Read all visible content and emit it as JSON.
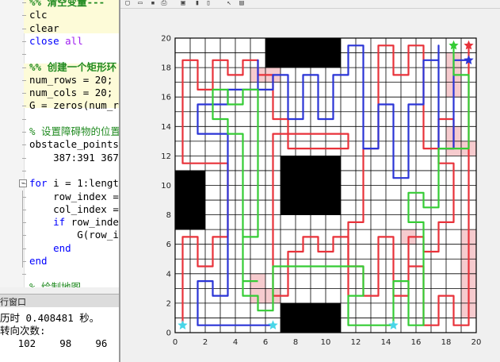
{
  "editor": {
    "lines": [
      {
        "text_cell": "%% 清空变量---",
        "top": -6
      },
      {
        "text": "clc"
      },
      {
        "text": "clear"
      },
      {
        "kw": "close ",
        "str": "all"
      },
      {
        "blank": true
      },
      {
        "text_cell": "%% 创建一个矩形环"
      },
      {
        "text": "num_rows = 20;"
      },
      {
        "text": "num_cols = 20;"
      },
      {
        "text": "G = zeros(num_row"
      },
      {
        "blank": true
      },
      {
        "text_cm": "% 设置障碍物的位置"
      },
      {
        "text": "obstacle_points ="
      },
      {
        "text": "    387:391 367:3"
      },
      {
        "blank": true
      },
      {
        "kw": "for ",
        "text": "i = 1:length("
      },
      {
        "text": "    row_index = c"
      },
      {
        "text": "    col_index = m"
      },
      {
        "kw": "    if ",
        "text": "row_index "
      },
      {
        "text": "        G(row_ind"
      },
      {
        "kw": "    end"
      },
      {
        "kw": "end"
      },
      {
        "blank": true
      },
      {
        "text_cm": "% 绘制地图"
      }
    ]
  },
  "command_window": {
    "title": "行窗口",
    "lines": [
      "历时 0.408481 秒。",
      "转向次数:",
      "   102    98    96"
    ]
  },
  "toolbar": {
    "icons": [
      "new-figure-icon",
      "open-icon",
      "save-icon",
      "print-icon",
      "print-preview-icon",
      "insert-colorbar-icon",
      "insert-legend-icon",
      "pointer-icon",
      "property-editor-icon"
    ]
  },
  "chart_data": {
    "type": "line",
    "xlim": [
      0,
      20
    ],
    "ylim": [
      0,
      20
    ],
    "xticks": [
      0,
      2,
      4,
      6,
      8,
      10,
      12,
      14,
      16,
      18,
      20
    ],
    "yticks": [
      0,
      2,
      4,
      6,
      8,
      10,
      12,
      14,
      16,
      18,
      20
    ],
    "grid": true,
    "obstacles": [
      {
        "x": [
          6,
          11
        ],
        "y": [
          18,
          20
        ]
      },
      {
        "x": [
          7,
          11
        ],
        "y": [
          8,
          12
        ]
      },
      {
        "x": [
          0,
          2
        ],
        "y": [
          7,
          11
        ]
      },
      {
        "x": [
          7,
          11
        ],
        "y": [
          0,
          2
        ]
      }
    ],
    "overlap_cells": [
      [
        5,
        17
      ],
      [
        6,
        17
      ],
      [
        18,
        18
      ],
      [
        18,
        17
      ],
      [
        18,
        16
      ],
      [
        18,
        13
      ],
      [
        18,
        12
      ],
      [
        19,
        12
      ],
      [
        15,
        6
      ],
      [
        19,
        6
      ],
      [
        19,
        5
      ],
      [
        19,
        4
      ],
      [
        19,
        3
      ],
      [
        19,
        2
      ],
      [
        19,
        1
      ],
      [
        6,
        2
      ],
      [
        5,
        2
      ],
      [
        5,
        3
      ]
    ],
    "series": [
      {
        "color": "#e8323a",
        "start": [
          19.5,
          18.5
        ],
        "end": [
          0.5,
          0.5
        ],
        "points": [
          [
            19.5,
            19.5
          ],
          [
            19.5,
            14.5
          ],
          [
            19.5,
            6.5
          ],
          [
            19.5,
            0.5
          ],
          [
            18.5,
            0.5
          ],
          [
            18.5,
            2.5
          ],
          [
            17.5,
            2.5
          ],
          [
            17.5,
            0.5
          ],
          [
            16.5,
            0.5
          ],
          [
            16.5,
            4.5
          ],
          [
            15.5,
            4.5
          ],
          [
            15.5,
            6.5
          ],
          [
            16.5,
            6.5
          ],
          [
            16.5,
            5.5
          ],
          [
            17.5,
            5.5
          ],
          [
            17.5,
            7.5
          ],
          [
            18.5,
            7.5
          ],
          [
            18.5,
            11.5
          ],
          [
            17.5,
            11.5
          ],
          [
            17.5,
            12.5
          ],
          [
            18.5,
            12.5
          ],
          [
            18.5,
            14.5
          ],
          [
            17.5,
            14.5
          ],
          [
            17.5,
            11.5
          ],
          [
            17.5,
            12.5
          ],
          [
            16.5,
            12.5
          ],
          [
            16.5,
            19.5
          ],
          [
            15.5,
            19.5
          ],
          [
            15.5,
            17.5
          ],
          [
            14.5,
            17.5
          ],
          [
            14.5,
            19.5
          ],
          [
            13.5,
            19.5
          ],
          [
            13.5,
            12.5
          ],
          [
            12.5,
            12.5
          ],
          [
            12.5,
            7.5
          ],
          [
            11.5,
            7.5
          ],
          [
            11.5,
            4.5
          ],
          [
            12.5,
            4.5
          ],
          [
            12.5,
            2.5
          ],
          [
            13.5,
            2.5
          ],
          [
            13.5,
            6.5
          ],
          [
            14.5,
            6.5
          ],
          [
            14.5,
            2.5
          ],
          [
            15.5,
            2.5
          ],
          [
            15.5,
            4.5
          ],
          [
            16.5,
            4.5
          ],
          [
            16.5,
            0.5
          ],
          [
            16.5,
            4.5
          ]
        ],
        "extra_runs": [
          [
            [
              0.5,
              0.5
            ],
            [
              0.5,
              6.5
            ],
            [
              1.5,
              6.5
            ],
            [
              1.5,
              4.5
            ],
            [
              2.5,
              4.5
            ],
            [
              2.5,
              6.5
            ],
            [
              3.5,
              6.5
            ],
            [
              3.5,
              11.5
            ],
            [
              0.5,
              11.5
            ],
            [
              0.5,
              18.5
            ],
            [
              1.5,
              18.5
            ],
            [
              1.5,
              16.5
            ],
            [
              2.5,
              16.5
            ],
            [
              2.5,
              18.5
            ],
            [
              3.5,
              18.5
            ],
            [
              3.5,
              17.5
            ],
            [
              4.5,
              17.5
            ],
            [
              4.5,
              18.5
            ],
            [
              5.5,
              18.5
            ],
            [
              5.5,
              17.5
            ],
            [
              6.5,
              17.5
            ],
            [
              6.5,
              14.5
            ],
            [
              7.5,
              14.5
            ],
            [
              7.5,
              12.5
            ],
            [
              11.5,
              12.5
            ],
            [
              11.5,
              13.5
            ],
            [
              6.5,
              13.5
            ],
            [
              6.5,
              2.5
            ],
            [
              7.5,
              2.5
            ],
            [
              7.5,
              5.5
            ],
            [
              8.5,
              5.5
            ],
            [
              8.5,
              6.5
            ],
            [
              9.5,
              6.5
            ],
            [
              9.5,
              5.5
            ],
            [
              10.5,
              5.5
            ],
            [
              10.5,
              6.5
            ],
            [
              11.5,
              6.5
            ],
            [
              11.5,
              2.5
            ]
          ]
        ]
      },
      {
        "color": "#2b35d6",
        "start": [
          19.5,
          18.5
        ],
        "end": [
          6.5,
          0.5
        ],
        "points": [
          [
            19.5,
            18.5
          ],
          [
            18.5,
            18.5
          ],
          [
            18.5,
            12.5
          ],
          [
            17.5,
            12.5
          ],
          [
            17.5,
            19.5
          ],
          [
            17.5,
            18.5
          ],
          [
            16.5,
            18.5
          ],
          [
            16.5,
            15.5
          ],
          [
            15.5,
            15.5
          ],
          [
            15.5,
            10.5
          ],
          [
            14.5,
            10.5
          ],
          [
            14.5,
            15.5
          ],
          [
            13.5,
            15.5
          ],
          [
            13.5,
            12.5
          ],
          [
            12.5,
            12.5
          ],
          [
            12.5,
            19.5
          ],
          [
            11.5,
            19.5
          ],
          [
            11.5,
            17.5
          ],
          [
            10.5,
            17.5
          ],
          [
            10.5,
            14.5
          ],
          [
            9.5,
            14.5
          ],
          [
            9.5,
            17.5
          ],
          [
            8.5,
            17.5
          ],
          [
            8.5,
            14.5
          ],
          [
            7.5,
            14.5
          ],
          [
            7.5,
            17.5
          ],
          [
            6.5,
            17.5
          ],
          [
            6.5,
            16.5
          ],
          [
            5.5,
            16.5
          ],
          [
            5.5,
            18.5
          ],
          [
            5.5,
            16.5
          ],
          [
            3.5,
            16.5
          ],
          [
            3.5,
            15.5
          ],
          [
            1.5,
            15.5
          ],
          [
            1.5,
            13.5
          ],
          [
            3.5,
            13.5
          ],
          [
            3.5,
            2.5
          ],
          [
            2.5,
            2.5
          ],
          [
            2.5,
            3.5
          ],
          [
            1.5,
            3.5
          ],
          [
            1.5,
            0.5
          ],
          [
            6.5,
            0.5
          ]
        ]
      },
      {
        "color": "#35cc35",
        "start": [
          18.5,
          19.5
        ],
        "end": [
          14.5,
          0.5
        ],
        "points": [
          [
            18.5,
            19.5
          ],
          [
            18.5,
            17.5
          ],
          [
            19.5,
            17.5
          ],
          [
            19.5,
            12.5
          ],
          [
            17.5,
            12.5
          ],
          [
            17.5,
            8.5
          ],
          [
            16.5,
            8.5
          ],
          [
            16.5,
            9.5
          ],
          [
            15.5,
            9.5
          ],
          [
            15.5,
            7.5
          ],
          [
            16.5,
            7.5
          ],
          [
            16.5,
            0.5
          ],
          [
            15.5,
            0.5
          ],
          [
            15.5,
            3.5
          ],
          [
            14.5,
            3.5
          ],
          [
            14.5,
            0.5
          ],
          [
            11.5,
            0.5
          ],
          [
            11.5,
            2.5
          ],
          [
            12.5,
            2.5
          ],
          [
            12.5,
            4.5
          ],
          [
            6.5,
            4.5
          ],
          [
            6.5,
            1.5
          ],
          [
            5.5,
            1.5
          ],
          [
            5.5,
            2.5
          ],
          [
            4.5,
            2.5
          ],
          [
            4.5,
            6.5
          ],
          [
            5.5,
            6.5
          ],
          [
            5.5,
            16.5
          ],
          [
            4.5,
            16.5
          ],
          [
            4.5,
            15.5
          ],
          [
            3.5,
            15.5
          ],
          [
            3.5,
            16.5
          ],
          [
            2.5,
            16.5
          ],
          [
            2.5,
            14.5
          ],
          [
            3.5,
            14.5
          ],
          [
            3.5,
            13.5
          ],
          [
            4.5,
            13.5
          ],
          [
            4.5,
            3.5
          ],
          [
            5.5,
            3.5
          ]
        ]
      }
    ],
    "markers": [
      {
        "x": 19.5,
        "y": 19.5,
        "color": "#e8323a",
        "label": "red-start-star"
      },
      {
        "x": 18.5,
        "y": 19.5,
        "color": "#35cc35",
        "label": "green-start-star"
      },
      {
        "x": 19.5,
        "y": 18.5,
        "color": "#2b35d6",
        "label": "blue-start-star"
      },
      {
        "x": 0.5,
        "y": 0.5,
        "color": "#48d6e8",
        "label": "end-star-1"
      },
      {
        "x": 6.5,
        "y": 0.5,
        "color": "#48d6e8",
        "label": "end-star-2"
      },
      {
        "x": 14.5,
        "y": 0.5,
        "color": "#48d6e8",
        "label": "end-star-3"
      }
    ]
  }
}
